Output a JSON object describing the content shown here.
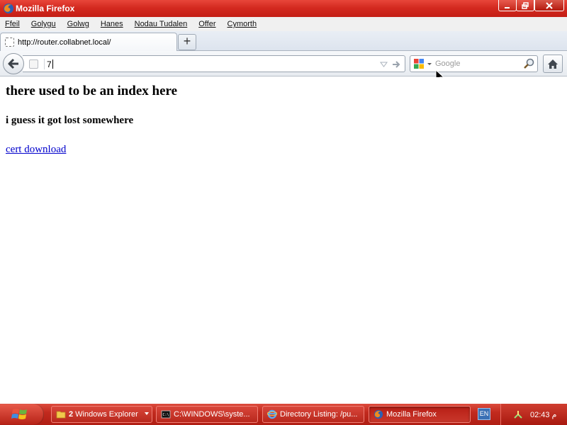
{
  "window": {
    "title": "Mozilla Firefox"
  },
  "menu": {
    "items": [
      "Ffeil",
      "Golygu",
      "Golwg",
      "Hanes",
      "Nodau Tudalen",
      "Offer",
      "Cymorth"
    ]
  },
  "tabs": [
    {
      "title": "http://router.collabnet.local/"
    }
  ],
  "newtab": {
    "label": "+"
  },
  "urlbar": {
    "value": "7"
  },
  "searchbar": {
    "placeholder": "Google",
    "engine": "google-icon"
  },
  "content": {
    "heading": "there used to be an index here",
    "subheading": "i guess it got lost somewhere",
    "link": "cert download"
  },
  "taskbar": {
    "tasks": [
      {
        "count": "2",
        "label": "Windows Explorer",
        "icon": "folder-icon"
      },
      {
        "label": "C:\\WINDOWS\\syste...",
        "icon": "cmd-icon"
      },
      {
        "label": "Directory Listing: /pu...",
        "icon": "ie-icon"
      },
      {
        "label": "Mozilla Firefox",
        "icon": "firefox-icon"
      }
    ],
    "language": "EN",
    "clock": "02:43 م"
  },
  "colors": {
    "titlebar": "#d42a20",
    "taskbar": "#c22a1e",
    "link": "#0000cc"
  }
}
